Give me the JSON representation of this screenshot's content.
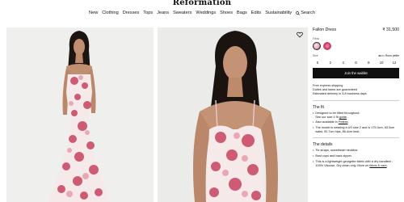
{
  "header": {
    "logo": "Reformation",
    "nav": [
      "New",
      "Clothing",
      "Dresses",
      "Tops",
      "Jeans",
      "Sweaters",
      "Weddings",
      "Shoes",
      "Bags",
      "Edits",
      "Sustainability"
    ],
    "search_label": "Search"
  },
  "product": {
    "name": "Fallon Dress",
    "price": "₹ 31,500",
    "color_label": "Fiera",
    "size_label": "Size",
    "fit_label": "Runs petite",
    "sizes": [
      "0",
      "2",
      "4",
      "6",
      "8",
      "10",
      "12"
    ],
    "cta": "Join the waitlist"
  },
  "shipping": [
    "Free express shipping",
    "Duties and taxes are guaranteed",
    "Estimated delivery in 3-8 business days"
  ],
  "fit": {
    "title": "The fit",
    "b1_line1": "Designed to be fitted throughout.",
    "b1_line2_pre": "See our size 4 fit ",
    "b1_link": "guide",
    "b1_end": ".",
    "b2_pre": "Also available in ",
    "b2_link": "Petites",
    "b2_end": ".",
    "b3": "The model is wearing a US size 2 and is 175.3cm, 63.5cm waist, 92.7cm hips, 86.4cm bust."
  },
  "details": {
    "title": "The details",
    "b1": "Tie straps, sweetheart neckline.",
    "b2": "Bust cups and back zipper.",
    "b3_pre": "This is a lightweight georgette fabric with a dry handfeel - 100% Viscose. Dry clean only. More on ",
    "b3_link": "fabric & care",
    "b3_end": "."
  },
  "colors": {
    "swatch1": "#e8b9c4",
    "swatch2": "#c8416a"
  }
}
